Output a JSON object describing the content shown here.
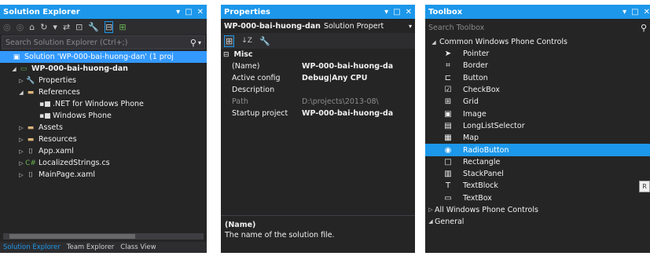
{
  "solution_explorer": {
    "title": "Solution Explorer",
    "title_buttons": [
      "▾",
      "□",
      "✕"
    ],
    "toolbar_icons": [
      "◎",
      "◎",
      "⌂",
      "↻",
      "▾",
      "⇄",
      "⊡",
      "🔧",
      "⊟",
      "⊞"
    ],
    "search_placeholder": "Search Solution Explorer (Ctrl+;)",
    "search_icon": "⚲",
    "tree": [
      {
        "label": "Solution 'WP-000-bai-huong-dan' (1 proj",
        "arrow": "",
        "icon": "▣",
        "icon_color": "#c5c5c5",
        "indent": 0,
        "selected": true,
        "bold": false
      },
      {
        "label": "WP-000-bai-huong-dan",
        "arrow": "◢",
        "icon": "▭",
        "icon_color": "#68b04f",
        "indent": 1,
        "selected": false,
        "bold": true
      },
      {
        "label": "Properties",
        "arrow": "▷",
        "icon": "🔧",
        "icon_color": "#e0e0e0",
        "indent": 2,
        "selected": false,
        "bold": false
      },
      {
        "label": "References",
        "arrow": "◢",
        "icon": "▬",
        "icon_color": "#dcb67a",
        "indent": 2,
        "selected": false,
        "bold": false
      },
      {
        "label": ".NET for Windows Phone",
        "arrow": "",
        "icon": "▪■",
        "icon_color": "#e0e0e0",
        "indent": 4,
        "selected": false,
        "bold": false
      },
      {
        "label": "Windows Phone",
        "arrow": "",
        "icon": "▪■",
        "icon_color": "#e0e0e0",
        "indent": 4,
        "selected": false,
        "bold": false
      },
      {
        "label": "Assets",
        "arrow": "▷",
        "icon": "▬",
        "icon_color": "#dcb67a",
        "indent": 2,
        "selected": false,
        "bold": false
      },
      {
        "label": "Resources",
        "arrow": "▷",
        "icon": "▬",
        "icon_color": "#dcb67a",
        "indent": 2,
        "selected": false,
        "bold": false
      },
      {
        "label": "App.xaml",
        "arrow": "▷",
        "icon": "⌷",
        "icon_color": "#e0e0e0",
        "indent": 2,
        "selected": false,
        "bold": false
      },
      {
        "label": "LocalizedStrings.cs",
        "arrow": "▷",
        "icon": "C#",
        "icon_color": "#68b04f",
        "indent": 2,
        "selected": false,
        "bold": false
      },
      {
        "label": "MainPage.xaml",
        "arrow": "▷",
        "icon": "⌷",
        "icon_color": "#e0e0e0",
        "indent": 2,
        "selected": false,
        "bold": false
      }
    ],
    "tabs": [
      "Solution Explorer",
      "Team Explorer",
      "Class View"
    ]
  },
  "properties": {
    "title": "Properties",
    "title_buttons": [
      "▾",
      "□",
      "✕"
    ],
    "object_name": "WP-000-bai-huong-dan",
    "object_type": "Solution Propert",
    "object_dropdown": "▾",
    "toolbar_icons": [
      "⊞",
      "↓Z",
      "🔧"
    ],
    "category": "Misc",
    "category_toggle": "⊟",
    "rows": [
      {
        "key": "(Name)",
        "value": "WP-000-bai-huong-da",
        "dim": false
      },
      {
        "key": "Active config",
        "value": "Debug|Any CPU",
        "dim": false
      },
      {
        "key": "Description",
        "value": "",
        "dim": false
      },
      {
        "key": "Path",
        "value": "D:\\projects\\2013-08\\",
        "dim": true
      },
      {
        "key": "Startup project",
        "value": "WP-000-bai-huong-da",
        "dim": false
      }
    ],
    "desc_title": "(Name)",
    "desc_text": "The name of the solution file."
  },
  "toolbox": {
    "title": "Toolbox",
    "title_buttons": [
      "▾",
      "□",
      "✕"
    ],
    "search_placeholder": "Search Toolbox",
    "search_icon": "⚲",
    "group_common": "Common Windows Phone Controls",
    "group_arrow_open": "◢",
    "items": [
      {
        "label": "Pointer",
        "icon": "➤",
        "selected": false
      },
      {
        "label": "Border",
        "icon": "⌗",
        "selected": false
      },
      {
        "label": "Button",
        "icon": "⊏",
        "selected": false
      },
      {
        "label": "CheckBox",
        "icon": "☑",
        "selected": false
      },
      {
        "label": "Grid",
        "icon": "⊞",
        "selected": false
      },
      {
        "label": "Image",
        "icon": "▣",
        "selected": false
      },
      {
        "label": "LongListSelector",
        "icon": "▤",
        "selected": false
      },
      {
        "label": "Map",
        "icon": "▦",
        "selected": false
      },
      {
        "label": "RadioButton",
        "icon": "◉",
        "selected": true
      },
      {
        "label": "Rectangle",
        "icon": "□",
        "selected": false
      },
      {
        "label": "StackPanel",
        "icon": "▥",
        "selected": false
      },
      {
        "label": "TextBlock",
        "icon": "T",
        "selected": false
      },
      {
        "label": "TextBox",
        "icon": "▭",
        "selected": false
      }
    ],
    "group_all": "All Windows Phone Controls",
    "group_arrow_closed": "▷",
    "group_general": "General",
    "tooltip_glyph": "R"
  }
}
